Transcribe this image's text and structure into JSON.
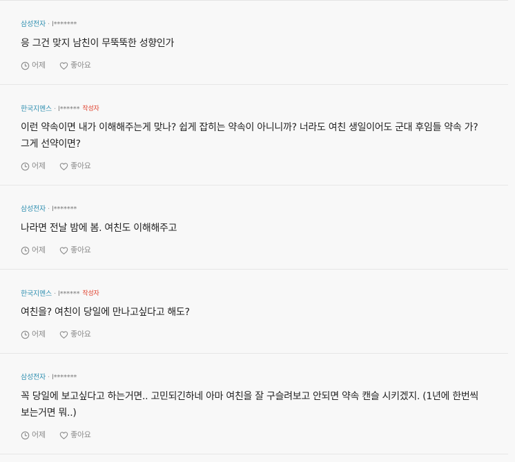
{
  "comments": [
    {
      "company": "삼성전자",
      "separator": "·",
      "author": "l*******",
      "is_op": false,
      "op_badge": "",
      "text": "응 그건 맞지 남친이 무뚝뚝한 성향인가",
      "time": "어제",
      "like_label": "좋아요"
    },
    {
      "company": "한국지멘스",
      "separator": "·",
      "author": "l******",
      "is_op": true,
      "op_badge": "작성자",
      "text": "이런 약속이면 내가 이해해주는게 맞나? 쉽게 잡히는 약속이 아니니까? 너라도 여친 생일이어도 군대 후임들 약속 가? 그게 선약이면?",
      "time": "어제",
      "like_label": "좋아요"
    },
    {
      "company": "삼성전자",
      "separator": "·",
      "author": "l*******",
      "is_op": false,
      "op_badge": "",
      "text": "나라면 전날 밤에 봄. 여친도 이해해주고",
      "time": "어제",
      "like_label": "좋아요"
    },
    {
      "company": "한국지멘스",
      "separator": "·",
      "author": "l******",
      "is_op": true,
      "op_badge": "작성자",
      "text": "여친을? 여친이 당일에 만나고싶다고 해도?",
      "time": "어제",
      "like_label": "좋아요"
    },
    {
      "company": "삼성전자",
      "separator": "·",
      "author": "l*******",
      "is_op": false,
      "op_badge": "",
      "text": "꼭 당일에 보고싶다고 하는거면.. 고민되긴하네 아마 여친을 잘 구슬려보고 안되면 약속 캔슬 시키겠지. (1년에 한번씩 보는거면 뭐..)",
      "time": "어제",
      "like_label": "좋아요"
    }
  ]
}
